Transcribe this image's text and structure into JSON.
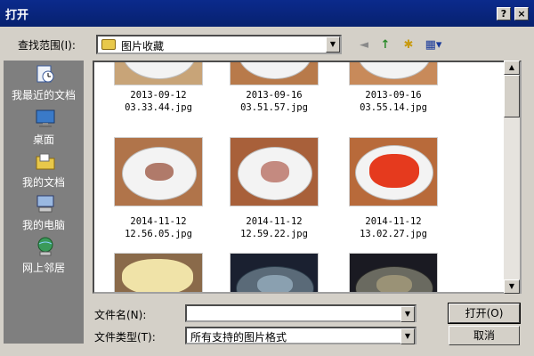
{
  "window": {
    "title": "打开",
    "help_glyph": "?",
    "close_glyph": "×"
  },
  "lookin": {
    "label": "查找范围(I):",
    "value": "图片收藏",
    "arrow": "▼"
  },
  "toolbar": {
    "back": "◄",
    "up": "↑",
    "new_folder": "✱",
    "views": "▦▾"
  },
  "places": [
    {
      "label": "我最近的文档",
      "icon": "recent-documents-icon"
    },
    {
      "label": "桌面",
      "icon": "desktop-icon"
    },
    {
      "label": "我的文档",
      "icon": "my-documents-icon"
    },
    {
      "label": "我的电脑",
      "icon": "my-computer-icon"
    },
    {
      "label": "网上邻居",
      "icon": "network-icon"
    }
  ],
  "files": [
    {
      "date": "2013-09-12",
      "name": "03.33.44.jpg",
      "food": "#6b3a22"
    },
    {
      "date": "2013-09-16",
      "name": "03.51.57.jpg",
      "food": "#b8542c"
    },
    {
      "date": "2013-09-16",
      "name": "03.55.14.jpg",
      "food": "#d8623a"
    },
    {
      "date": "2014-11-12",
      "name": "12.56.05.jpg",
      "food": "#b07a6a"
    },
    {
      "date": "2014-11-12",
      "name": "12.59.22.jpg",
      "food": "#c48a80"
    },
    {
      "date": "2014-11-12",
      "name": "13.02.27.jpg",
      "food": "#e53a1e"
    },
    {
      "date": "",
      "name": "",
      "food": "#f0e3a8"
    },
    {
      "date": "",
      "name": "",
      "food": "#8aa0b0"
    },
    {
      "date": "",
      "name": "",
      "food": "#9a9276"
    }
  ],
  "scrollbar": {
    "up": "▲",
    "down": "▼"
  },
  "filename": {
    "label": "文件名(N):",
    "value": "",
    "arrow": "▼"
  },
  "filetype": {
    "label": "文件类型(T):",
    "value": "所有支持的图片格式",
    "arrow": "▼"
  },
  "buttons": {
    "open": "打开(O)",
    "cancel": "取消"
  },
  "colors": {
    "title_bar": "#0b2a8c",
    "places_bar": "#7f7f7f",
    "dialog_bg": "#d4d0c8"
  }
}
